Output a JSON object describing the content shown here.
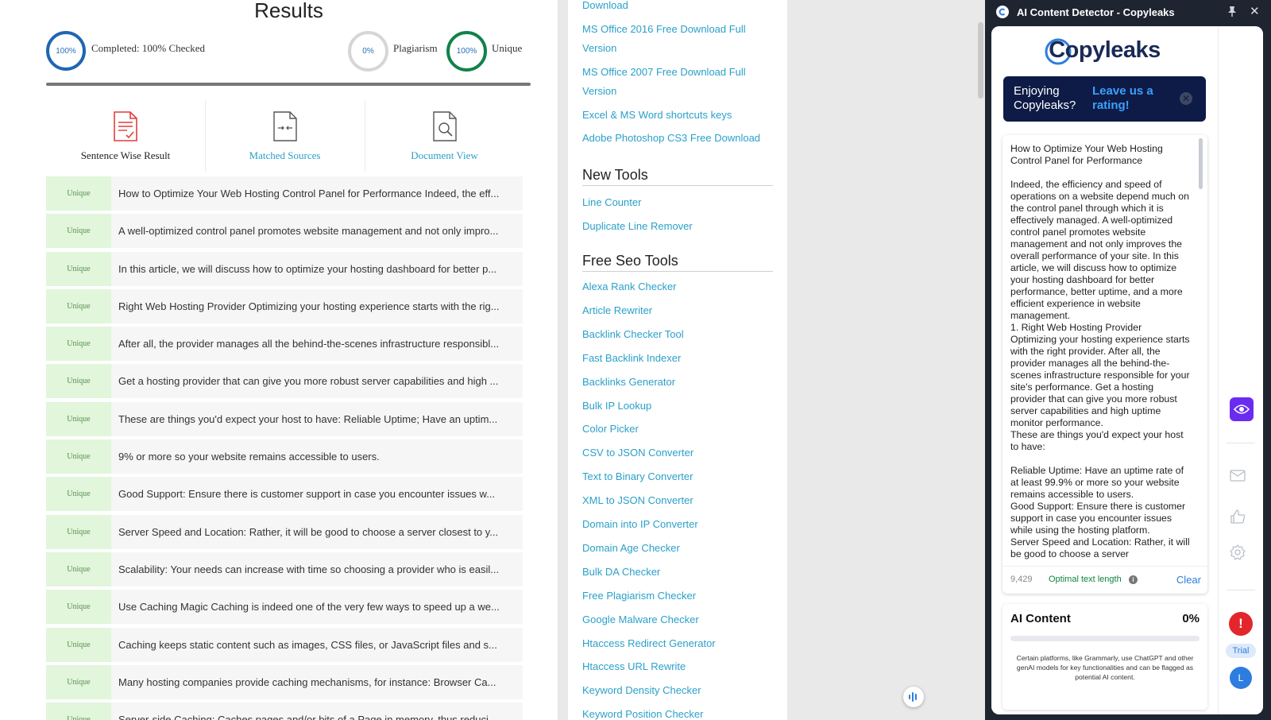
{
  "results": {
    "title": "Results",
    "completed": {
      "percent_label": "100%",
      "label": "Completed: 100% Checked"
    },
    "plagiarism": {
      "percent_label": "0%",
      "label": "Plagiarism"
    },
    "unique": {
      "percent_label": "100%",
      "label": "Unique"
    },
    "tabs": {
      "sentence": "Sentence Wise Result",
      "matched": "Matched Sources",
      "document": "Document View"
    },
    "rows": [
      {
        "badge": "Unique",
        "text": "How to Optimize Your Web Hosting Control Panel for Performance Indeed, the eff..."
      },
      {
        "badge": "Unique",
        "text": "A well-optimized control panel promotes website management and not only impro..."
      },
      {
        "badge": "Unique",
        "text": "In this article, we will discuss how to optimize your hosting dashboard for better p..."
      },
      {
        "badge": "Unique",
        "text": "Right Web Hosting Provider Optimizing your hosting experience starts with the rig..."
      },
      {
        "badge": "Unique",
        "text": "After all, the provider manages all the behind-the-scenes infrastructure responsibl..."
      },
      {
        "badge": "Unique",
        "text": "Get a hosting provider that can give you more robust server capabilities and high ..."
      },
      {
        "badge": "Unique",
        "text": "These are things you'd expect your host to have: Reliable Uptime; Have an uptim..."
      },
      {
        "badge": "Unique",
        "text": "9% or more so your website remains accessible to users."
      },
      {
        "badge": "Unique",
        "text": "Good Support: Ensure there is customer support in case you encounter issues w..."
      },
      {
        "badge": "Unique",
        "text": "Server Speed and Location: Rather, it will be good to choose a server closest to y..."
      },
      {
        "badge": "Unique",
        "text": "Scalability: Your needs can increase with time so choosing a provider who is easil..."
      },
      {
        "badge": "Unique",
        "text": "Use Caching Magic Caching is indeed one of the very few ways to speed up a we..."
      },
      {
        "badge": "Unique",
        "text": "Caching keeps static content such as images, CSS files, or JavaScript files and s..."
      },
      {
        "badge": "Unique",
        "text": "Many hosting companies provide caching mechanisms, for instance: Browser Ca..."
      },
      {
        "badge": "Unique",
        "text": "Server-side Caching: Caches pages and/or bits of a Page in memory, thus reduci..."
      }
    ]
  },
  "links": {
    "top_items": [
      "Download",
      "MS Office 2016 Free Download Full",
      "Version",
      "MS Office 2007 Free Download Full",
      "Version",
      "Excel & MS Word shortcuts keys",
      "Adobe Photoshop CS3 Free Download"
    ],
    "new_tools_title": "New Tools",
    "new_tools": [
      "Line Counter",
      "Duplicate Line Remover"
    ],
    "seo_title": "Free Seo Tools",
    "seo_tools": [
      "Alexa Rank Checker",
      "Article Rewriter",
      "Backlink Checker Tool",
      "Fast Backlink Indexer",
      "Backlinks Generator",
      "Bulk IP Lookup",
      "Color Picker",
      "CSV to JSON Converter",
      "Text to Binary Converter",
      "XML to JSON Converter",
      "Domain into IP Converter",
      "Domain Age Checker",
      "Bulk DA Checker",
      "Free Plagiarism Checker",
      "Google Malware Checker",
      "Htaccess Redirect Generator",
      "Htaccess URL Rewrite",
      "Keyword Density Checker",
      "Keyword Position Checker"
    ]
  },
  "extension": {
    "window_title": "AI Content Detector - Copyleaks",
    "brand": "Copyleaks",
    "rating_question": "Enjoying Copyleaks?",
    "rating_link": "Leave us a rating!",
    "text": "How to Optimize Your Web Hosting Control Panel for Performance\n\nIndeed, the efficiency and speed of operations on a website depend much on the control panel through which it is effectively managed. A well-optimized control panel promotes website management and not only improves the overall performance of your site. In this article, we will discuss how to optimize your hosting dashboard for better performance, better uptime, and a more efficient experience in website management.\n1. Right Web Hosting Provider\nOptimizing your hosting experience starts with the right provider. After all, the provider manages all the behind-the-scenes infrastructure responsible for your site's performance. Get a hosting provider that can give you more robust server capabilities and high uptime monitor performance.\nThese are things you'd expect your host to have:\n\nReliable Uptime: Have an uptime rate of at least 99.9% or more so your website remains accessible to users.\nGood Support: Ensure there is customer support in case you encounter issues while using the hosting platform.\nServer Speed and Location: Rather, it will be good to choose a server",
    "word_count": "9,429",
    "optimal_label": "Optimal text length",
    "clear_label": "Clear",
    "ai_title": "AI Content",
    "ai_percent": "0%",
    "ai_fraction": 0,
    "ai_note": "Certain platforms, like Grammarly, use ChatGPT and other genAI models for key functionalities and can be flagged as potential AI content.",
    "trial_label": "Trial",
    "avatar_initial": "L",
    "alert_symbol": "!",
    "colors": {
      "accent": "#2d7de0",
      "eye_button": "#6a2cf0",
      "alert": "#e3262b",
      "banner": "#0e1b46"
    }
  },
  "icons": [
    "document-check-icon",
    "matched-sources-icon",
    "document-view-icon",
    "pin-icon",
    "close-icon",
    "eye-icon",
    "mail-icon",
    "thumbs-up-icon",
    "gear-icon",
    "audio-icon"
  ]
}
